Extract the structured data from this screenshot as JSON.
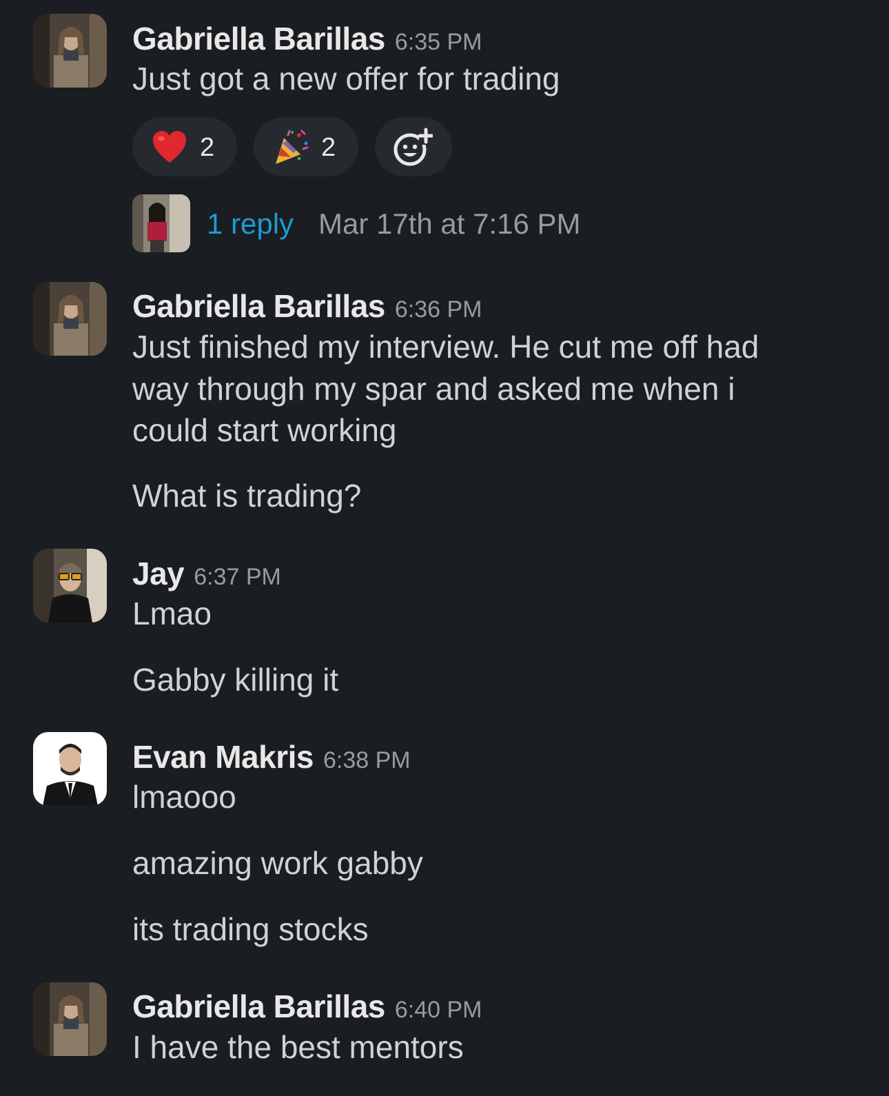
{
  "messages": [
    {
      "author": "Gabriella Barillas",
      "time": "6:35 PM",
      "lines": [
        "Just got a new offer for trading"
      ],
      "reactions": [
        {
          "emoji": "heart-emoji",
          "count": "2"
        },
        {
          "emoji": "party-popper-emoji",
          "count": "2"
        }
      ],
      "thread": {
        "reply_count": "1 reply",
        "last_reply": "Mar 17th at 7:16 PM"
      }
    },
    {
      "author": "Gabriella Barillas",
      "time": "6:36 PM",
      "lines": [
        "Just finished my interview. He cut me off had",
        "way through my spar and asked me when i",
        "could start working",
        "What is trading?"
      ]
    },
    {
      "author": "Jay",
      "time": "6:37 PM",
      "lines": [
        "Lmao",
        "Gabby killing it"
      ]
    },
    {
      "author": "Evan Makris",
      "time": "6:38 PM",
      "lines": [
        "lmaooo",
        "amazing work gabby",
        "its trading stocks"
      ]
    },
    {
      "author": "Gabriella Barillas",
      "time": "6:40 PM",
      "lines": [
        "I have the best mentors"
      ]
    }
  ],
  "colors": {
    "background": "#1a1d21",
    "text": "#d1d2d3",
    "author": "#e8e8e8",
    "timestamp": "#9a9b9d",
    "link": "#1d9bd1",
    "reaction_pill": "#26292e"
  },
  "icons": {
    "add_reaction": "add-reaction-icon"
  }
}
